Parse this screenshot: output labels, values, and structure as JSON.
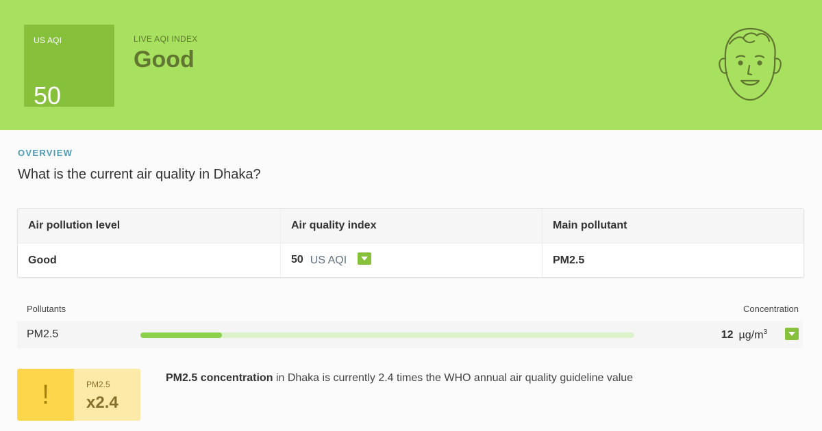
{
  "hero": {
    "aqi_label": "US AQI",
    "aqi_value": "50",
    "live_label": "LIVE AQI INDEX",
    "status": "Good",
    "face_icon": "smiling-face-icon",
    "color": "#a8e05f",
    "box_color": "#87c13c"
  },
  "overview": {
    "section_label": "OVERVIEW",
    "question": "What is the current air quality in Dhaka?"
  },
  "summary_table": {
    "headers": [
      "Air pollution level",
      "Air quality index",
      "Main pollutant"
    ],
    "level": "Good",
    "aqi_number": "50",
    "aqi_unit": "US AQI",
    "main_pollutant": "PM2.5",
    "trend_icon": "caret-down-icon"
  },
  "pollutants": {
    "header_left": "Pollutants",
    "header_right": "Concentration",
    "items": [
      {
        "name": "PM2.5",
        "value": "12",
        "unit": "µg/m",
        "unit_sup": "3",
        "level_fraction": 0.165
      }
    ]
  },
  "warning": {
    "icon_glyph": "!",
    "icon_name": "exclamation-icon",
    "label": "PM2.5",
    "multiplier": "x2.4",
    "text_bold": "PM2.5 concentration",
    "text_rest": " in Dhaka is currently 2.4 times the WHO annual air quality guideline value"
  }
}
